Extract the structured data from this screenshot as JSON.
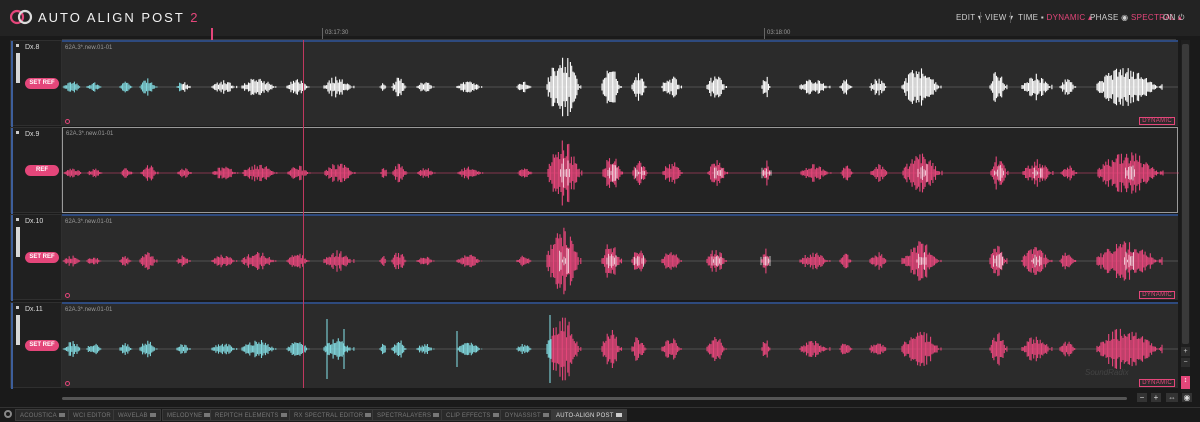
{
  "app": {
    "title": "AUTO ALIGN POST",
    "version": "2",
    "colors": {
      "accent": "#e4467a",
      "cyan": "#7fd6dc",
      "white": "#ffffff"
    }
  },
  "header": {
    "edit": "EDIT ▾",
    "view": "VIEW ▾",
    "time_label": "TIME ▪",
    "time_value": "DYNAMIC ▴",
    "phase_label": "PHASE ◉",
    "phase_value": "SPECTRAL ▴",
    "power": "ON ⏻"
  },
  "ruler": {
    "ticks": [
      "03:17:30",
      "03:18:00"
    ]
  },
  "tracks": [
    {
      "name": "Dx.8",
      "ref_label": "SET REF",
      "clip": "62A.3*.new.01-01",
      "badge": "DYNAMIC",
      "active": false
    },
    {
      "name": "Dx.9",
      "ref_label": "REF",
      "clip": "62A.3*.new.01-01",
      "badge": "",
      "active": true
    },
    {
      "name": "Dx.10",
      "ref_label": "SET REF",
      "clip": "62A.3*.new.01-01",
      "badge": "DYNAMIC",
      "active": false
    },
    {
      "name": "Dx.11",
      "ref_label": "SET REF",
      "clip": "62A.3*.new.01-01",
      "badge": "DYNAMIC",
      "active": false
    }
  ],
  "zoom": {
    "minus": "−",
    "plus": "+"
  },
  "footer": {
    "tabs": [
      "ACOUSTICA",
      "WCI EDITOR",
      "WAVELAB",
      "MELODYNE",
      "REPITCH ELEMENTS",
      "RX SPECTRAL EDITOR",
      "SPECTRALAYERS",
      "CLIP EFFECTS",
      "DYNASSIST",
      "AUTO-ALIGN POST"
    ],
    "active_tab": "AUTO-ALIGN POST"
  }
}
